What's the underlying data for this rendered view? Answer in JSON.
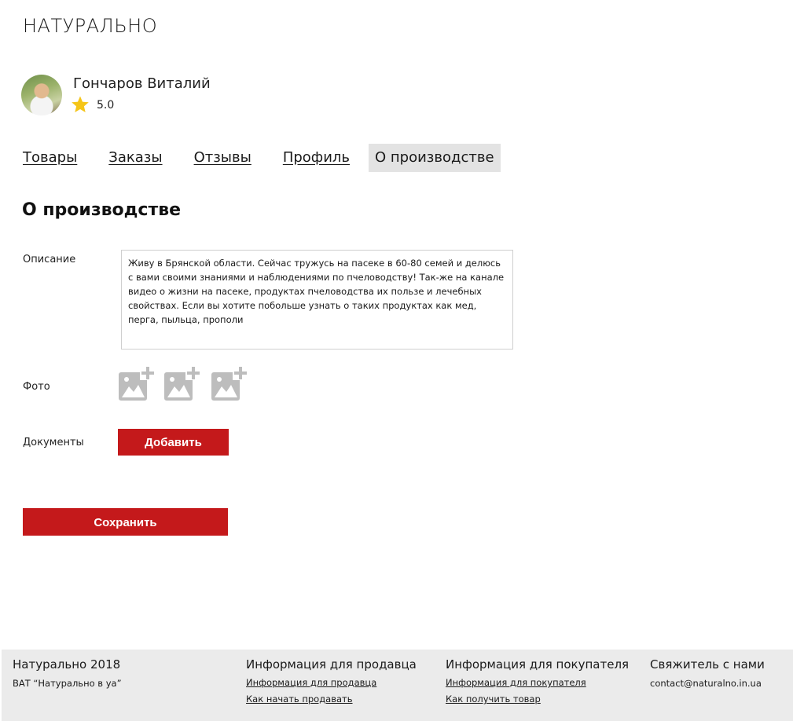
{
  "brand": {
    "logo_text": "НАТУРАЛЬНО"
  },
  "seller": {
    "name": "Гончаров Виталий",
    "rating": "5.0",
    "avatar_icon": "user-photo",
    "star_color": "#f5c518"
  },
  "tabs": [
    {
      "label": "Товары",
      "active": false
    },
    {
      "label": "Заказы",
      "active": false
    },
    {
      "label": "Отзывы",
      "active": false
    },
    {
      "label": "Профиль",
      "active": false
    },
    {
      "label": "О производстве",
      "active": true
    }
  ],
  "main": {
    "title": "О производстве",
    "description_label": "Описание",
    "description_value": "Живу в Брянской области. Сейчас тружусь на пасеке в 60-80 семей и делюсь с вами своими знаниями и наблюдениями по пчеловодству! Так-же на канале видео о жизни на пасеке, продуктах пчеловодства их пользе и лечебных свойствах. Если вы хотите побольше узнать о таких продуктах как мед, перга, пыльца, прополи",
    "photo_label": "Фото",
    "photo_slots": 3,
    "photo_icon": "add-photo-icon",
    "documents_label": "Документы",
    "add_button": "Добавить",
    "save_button": "Сохранить"
  },
  "colors": {
    "accent": "#c4191b",
    "tab_active_bg": "#e3e3e3",
    "footer_bg": "#ebebeb",
    "icon_gray": "#bdbdbd"
  },
  "footer": {
    "company": {
      "title": "Натурально 2018",
      "sub": "ВАТ “Натурально в уа”"
    },
    "seller_info": {
      "title": "Информация для продавца",
      "links": [
        "Информация для продавца",
        "Как начать продавать"
      ]
    },
    "buyer_info": {
      "title": "Информация для покупателя",
      "links": [
        "Информация для покупателя",
        "Как получить товар"
      ]
    },
    "contact": {
      "title": "Свяжитель с нами",
      "email": "contact@naturalno.in.ua"
    }
  }
}
